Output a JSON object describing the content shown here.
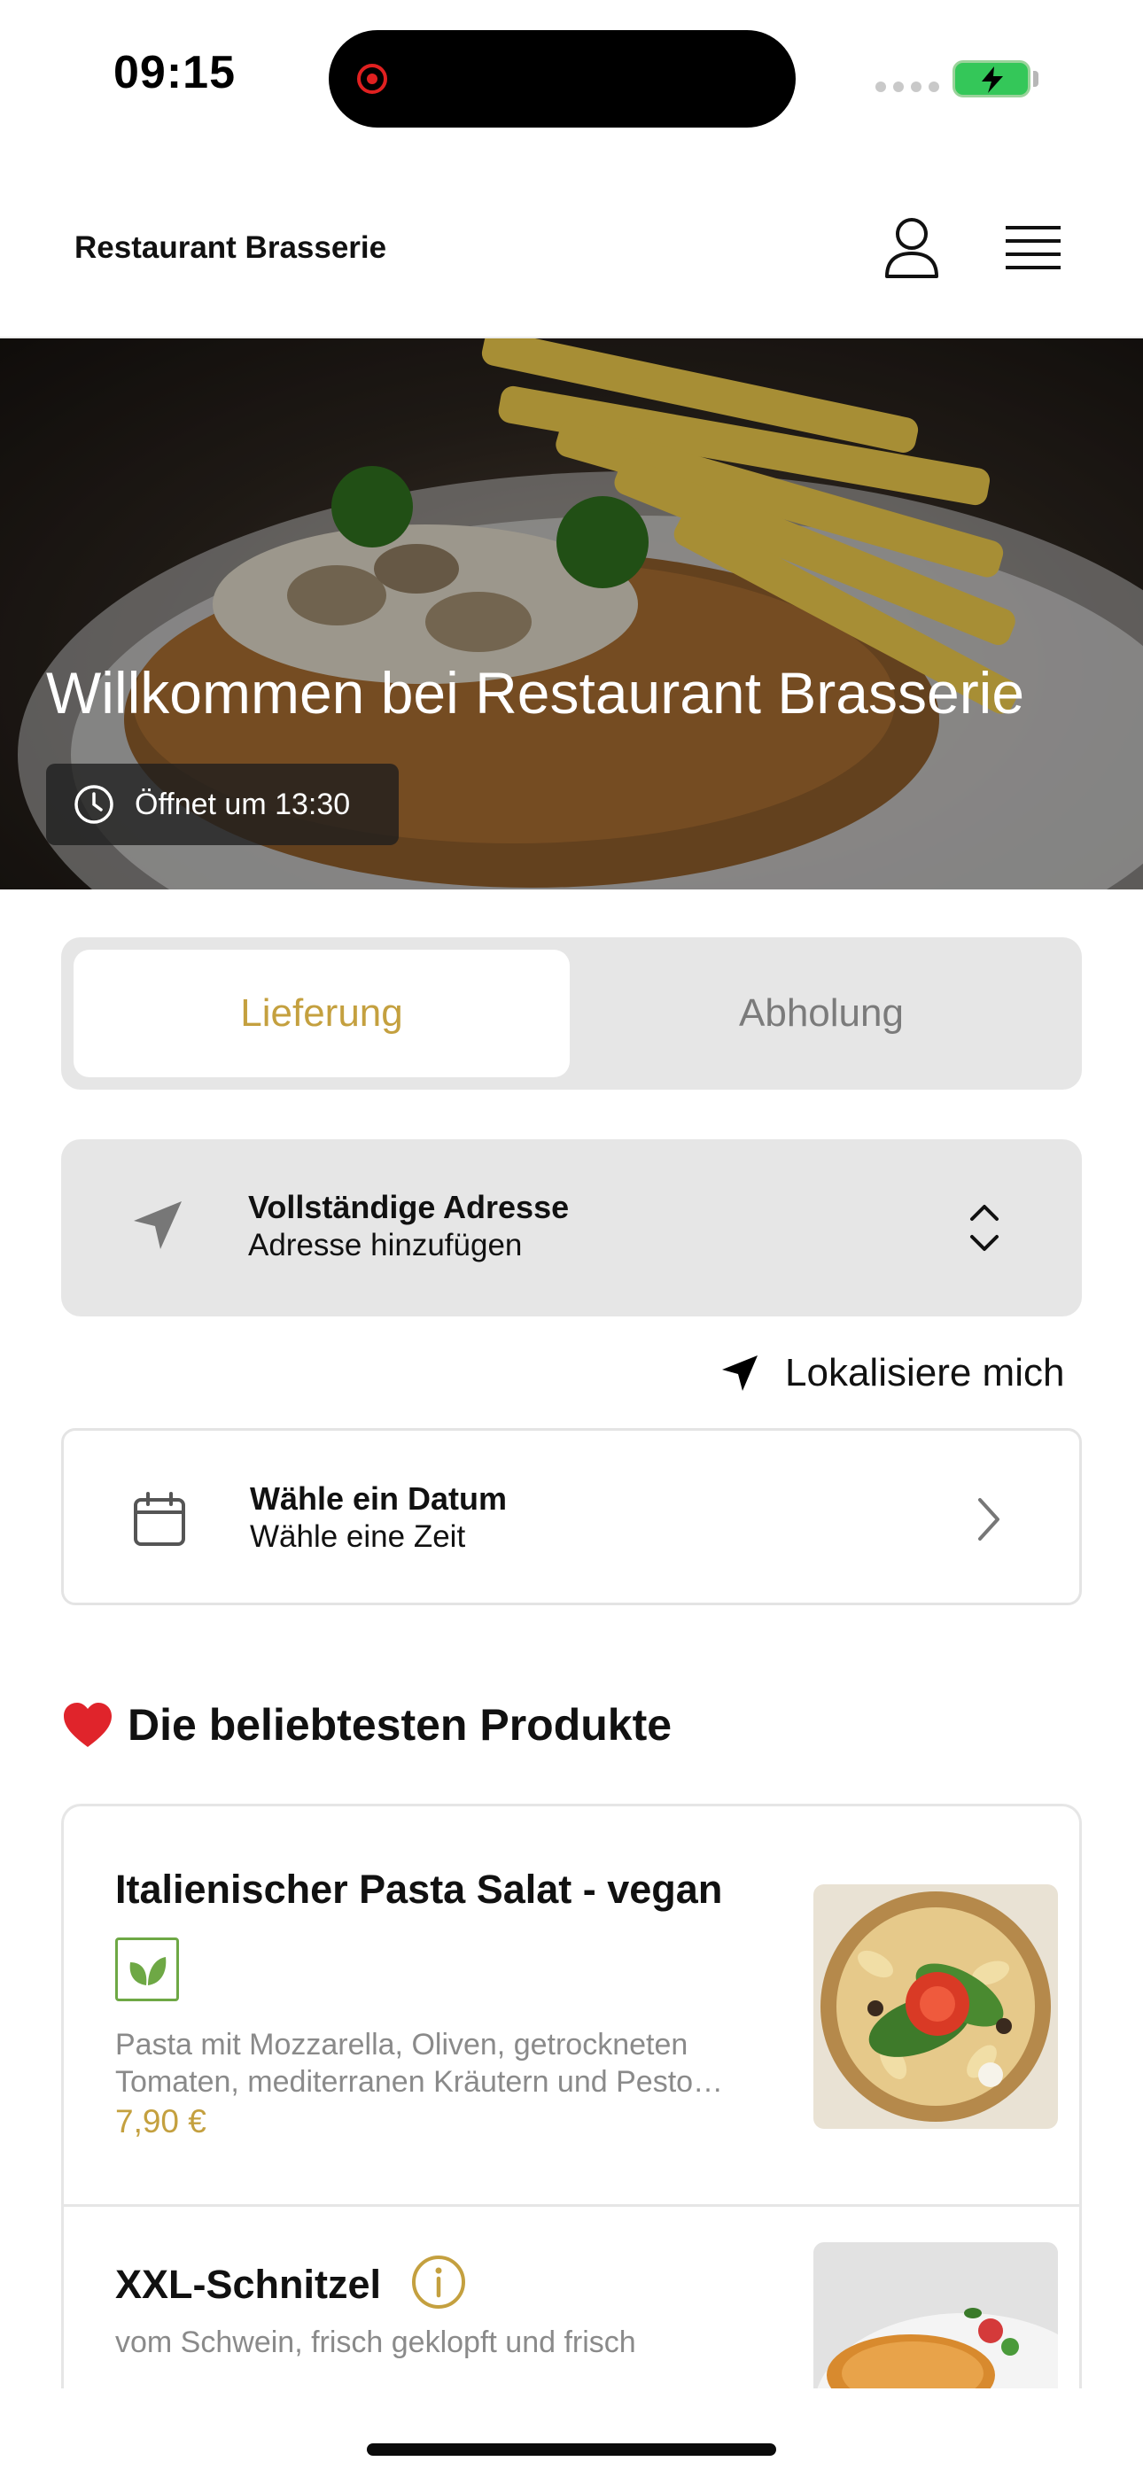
{
  "status_bar": {
    "time": "09:15"
  },
  "header": {
    "title": "Restaurant Brasserie"
  },
  "hero": {
    "title": "Willkommen bei Restaurant Brasserie",
    "opening_badge": "Öffnet um 13:30"
  },
  "mode_toggle": {
    "options": [
      "Lieferung",
      "Abholung"
    ],
    "selected": "Lieferung"
  },
  "address": {
    "title": "Vollständige Adresse",
    "subtitle": "Adresse hinzufügen"
  },
  "locate_label": "Lokalisiere mich",
  "schedule": {
    "title": "Wähle ein Datum",
    "subtitle": "Wähle eine Zeit"
  },
  "popular": {
    "heading": "Die beliebtesten Produkte",
    "products": [
      {
        "name": "Italienischer Pasta Salat - vegan",
        "description_line1": "Pasta mit Mozzarella, Oliven, getrockneten",
        "description_line2": "Tomaten, mediterranen Kräutern und Pesto…",
        "price": "7,90 €",
        "badge_icon": "leaf-icon"
      },
      {
        "name": "XXL-Schnitzel",
        "description_line1": "vom Schwein, frisch geklopft und frisch",
        "badge_icon": "info-icon"
      }
    ]
  },
  "colors": {
    "accent": "#c4a03f",
    "card_bg": "#e6e6e6",
    "vegan_green": "#6ea845"
  }
}
